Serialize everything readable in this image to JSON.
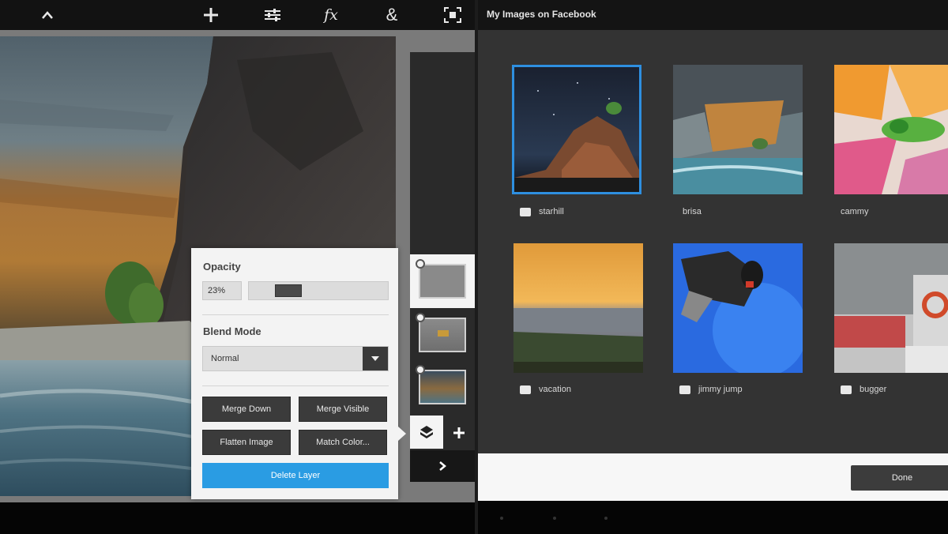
{
  "toolbar": {
    "icons": [
      "chevron-up-icon",
      "plus-icon",
      "adjustments-icon",
      "fx-icon",
      "ampersand-icon",
      "fullscreen-icon"
    ],
    "fx_label": "fx",
    "amp_label": "&"
  },
  "layer_panel": {
    "opacity_label": "Opacity",
    "opacity_value": "23%",
    "opacity_level": 0.23,
    "blend_mode_label": "Blend Mode",
    "blend_mode_value": "Normal",
    "buttons": {
      "merge_down": "Merge Down",
      "merge_visible": "Merge Visible",
      "flatten_image": "Flatten Image",
      "match_color": "Match Color..."
    },
    "delete_layer": "Delete Layer"
  },
  "gallery": {
    "title": "My Images on Facebook",
    "items": [
      {
        "caption": "starhill",
        "has_icon": true
      },
      {
        "caption": "brisa",
        "has_icon": false
      },
      {
        "caption": "cammy",
        "has_icon": false
      },
      {
        "caption": "vacation",
        "has_icon": true
      },
      {
        "caption": "jimmy jump",
        "has_icon": true
      },
      {
        "caption": "bugger",
        "has_icon": true
      }
    ],
    "done_label": "Done"
  },
  "colors": {
    "accent": "#2a9ce3",
    "selection": "#2e8fe0",
    "toolbar_bg": "#121212",
    "panel_bg": "#f3f3f3"
  }
}
